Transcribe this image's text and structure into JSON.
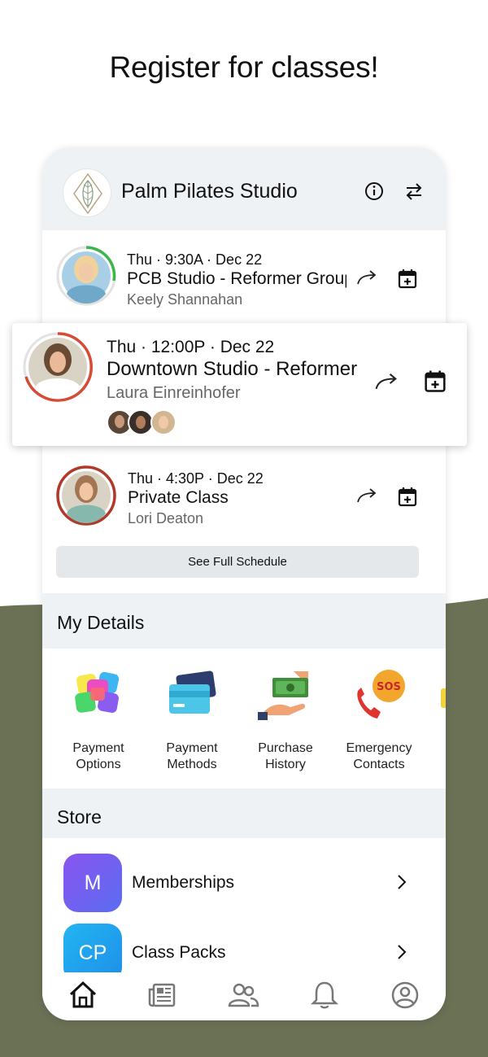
{
  "headline": "Register for classes!",
  "colors": {
    "olive": "#6b7155",
    "header_gray": "#eff2f5",
    "progress_green": "#3cb54a",
    "progress_red": "#d64a36",
    "store_purple": "#6e5cf0",
    "store_blue": "#20a6f0"
  },
  "studio": {
    "name": "Palm Pilates Studio",
    "info_icon": "info-icon",
    "switch_icon": "switch-arrows-icon"
  },
  "classes": [
    {
      "time": "Thu · 9:30A · Dec 22",
      "title": "PCB Studio - Reformer Group",
      "instructor": "Keely Shannahan",
      "progress": 0.3,
      "ring_color": "#3cb54a"
    },
    {
      "time": "Thu · 12:00P · Dec 22",
      "title": "Downtown Studio - Reformer",
      "instructor": "Laura Einreinhofer",
      "progress": 0.7,
      "ring_color": "#d64a36",
      "attendees": 3
    },
    {
      "time": "Thu · 4:30P · Dec 22",
      "title": "Private Class",
      "instructor": "Lori Deaton",
      "progress": 1.0,
      "ring_color": "#b0392a"
    }
  ],
  "schedule_button": "See Full Schedule",
  "my_details": {
    "title": "My Details",
    "items": [
      {
        "line1": "Payment",
        "line2": "Options",
        "icon": "color-tiles-icon"
      },
      {
        "line1": "Payment",
        "line2": "Methods",
        "icon": "credit-cards-icon"
      },
      {
        "line1": "Purchase",
        "line2": "History",
        "icon": "cash-hand-icon"
      },
      {
        "line1": "Emergency",
        "line2": "Contacts",
        "icon": "sos-phone-icon"
      }
    ]
  },
  "store": {
    "title": "Store",
    "items": [
      {
        "badge": "M",
        "label": "Memberships"
      },
      {
        "badge": "CP",
        "label": "Class Packs"
      }
    ]
  },
  "tabs": [
    "home-icon",
    "news-icon",
    "people-icon",
    "bell-icon",
    "account-icon"
  ]
}
